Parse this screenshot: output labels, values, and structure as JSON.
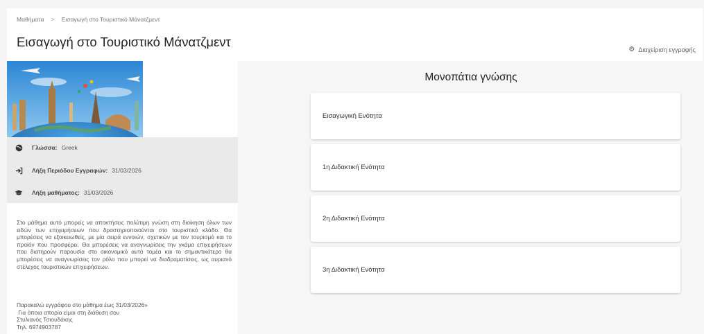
{
  "breadcrumb": {
    "root": "Μαθήματα",
    "separator": ">",
    "current": "Εισαγωγή στο Τουριστικό Μάνατζμεντ"
  },
  "page_title": "Εισαγωγή στο Τουριστικό Μάνατζμεντ",
  "manage_link": {
    "icon": "gear-icon",
    "label": "Διαχείριση εγγραφής"
  },
  "course_meta": {
    "language": {
      "icon": "globe-icon",
      "label": "Γλώσσα:",
      "value": "Greek"
    },
    "enrollment_end": {
      "icon": "sign-in-icon",
      "label": "Λήξη Περιόδου Εγγραφών:",
      "value": "31/03/2026"
    },
    "course_end": {
      "icon": "graduation-cap-icon",
      "label": "Λήξη μαθήματος:",
      "value": "31/03/2026"
    }
  },
  "description": "Στο μάθημα αυτό μπορείς να αποκτήσεις πολύτιμη γνώση στη διοίκηση όλων των ειδών των επιχειρήσεων που δραστηριοποιούνται στο τουριστικό κλάδο. Θα μπορέσεις να εξοικειωθείς, με μία σειρά εννοιών, σχετικών με τον τουρισμό και το προϊόν που προσφέρει. Θα μπορέσεις να αναγνωρίσεις την γκάμα επιχειρήσεων που διατηρούν παρουσία στο οικονομικό αυτό τομέα και το σημαντικότερο θα μπορέσεις να αναγνωρίσεις τον ρόλο που μπορεί να διαδραματίσεις, ως αυριανό στέλεχος τουριστικών επιχειρήσεων.",
  "note": {
    "line1": "Παρακαλώ εγγράφου στο μάθημα έως 31/03/2026»",
    "line2": " Για όποια απορία είμαι στη διάθεση σου",
    "line3": "Στυλιανός Τσιουδάκης",
    "line4": "Τηλ. 6974903787"
  },
  "learning_paths": {
    "title": "Μονοπάτια γνώσης",
    "items": [
      "Εισαγωγική Ενότητα",
      "1η Διδακτική Ενότητα",
      "2η Διδακτική Ενότητα",
      "3η Διδακτική Ενότητα"
    ]
  },
  "colors": {
    "page_bg": "#f5f5f5",
    "meta_bg": "#eaeaea",
    "card_bg": "#ffffff",
    "sky": "#3a8fd6",
    "globe": "#2f7cc4"
  }
}
